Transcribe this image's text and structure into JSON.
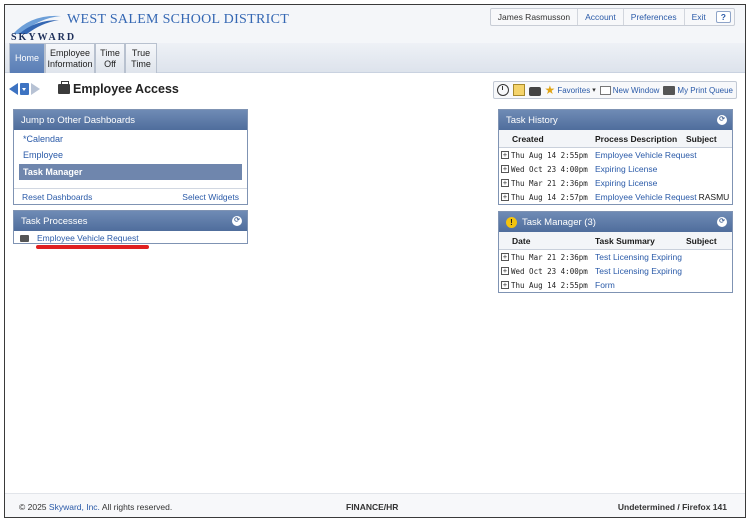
{
  "header": {
    "logo_text": "SKYWARD",
    "district_name": "WEST SALEM SCHOOL DISTRICT",
    "user_name": "James Rasmusson",
    "links": [
      "Account",
      "Preferences",
      "Exit"
    ],
    "help_label": "?"
  },
  "nav": {
    "tabs": [
      {
        "label": "Home",
        "active": true
      },
      {
        "label": "Employee Information",
        "line1": "Employee",
        "line2": "Information"
      },
      {
        "label": "Time Off",
        "line1": "Time",
        "line2": "Off"
      },
      {
        "label": "True Time",
        "line1": "True",
        "line2": "Time"
      }
    ]
  },
  "toolbar": {
    "page_title": "Employee Access",
    "favorites_label": "Favorites",
    "new_window_label": "New Window",
    "print_queue_label": "My Print Queue"
  },
  "jump_widget": {
    "title": "Jump to Other Dashboards",
    "items": [
      "*Calendar",
      "Employee",
      "Task Manager"
    ],
    "active_item": "Task Manager",
    "reset_label": "Reset Dashboards",
    "select_label": "Select Widgets"
  },
  "task_processes": {
    "title": "Task Processes",
    "items": [
      "Employee Vehicle Request"
    ]
  },
  "task_history": {
    "title": "Task History",
    "columns": [
      "Created",
      "Process Description",
      "Subject"
    ],
    "rows": [
      {
        "created": "Thu Aug 14  2:55pm",
        "description": "Employee Vehicle Request",
        "subject": ""
      },
      {
        "created": "Wed Oct 23  4:00pm",
        "description": "Expiring License",
        "subject": ""
      },
      {
        "created": "Thu Mar 21  2:36pm",
        "description": "Expiring License",
        "subject": ""
      },
      {
        "created": "Thu Aug 14  2:57pm",
        "description": "Employee Vehicle Request",
        "subject": "RASMU"
      }
    ]
  },
  "task_manager": {
    "title": "Task Manager (3)",
    "warn_glyph": "!",
    "columns": [
      "Date",
      "Task Summary",
      "Subject"
    ],
    "rows": [
      {
        "date": "Thu Mar 21  2:36pm",
        "summary": "Test Licensing Expiring"
      },
      {
        "date": "Wed Oct 23  4:00pm",
        "summary": "Test Licensing Expiring"
      },
      {
        "date": "Thu Aug 14  2:55pm",
        "summary": "Form"
      }
    ]
  },
  "footer": {
    "copyright_prefix": "© 2025 ",
    "company_link": "Skyward, Inc.",
    "copyright_suffix": " All rights reserved.",
    "module": "FINANCE/HR",
    "environment": "Undetermined / Firefox 141"
  },
  "colors": {
    "brand_blue": "#3467b3",
    "link_blue": "#2a5aa8",
    "widget_header": "#5a77a6",
    "highlight_underline": "#e02020"
  }
}
